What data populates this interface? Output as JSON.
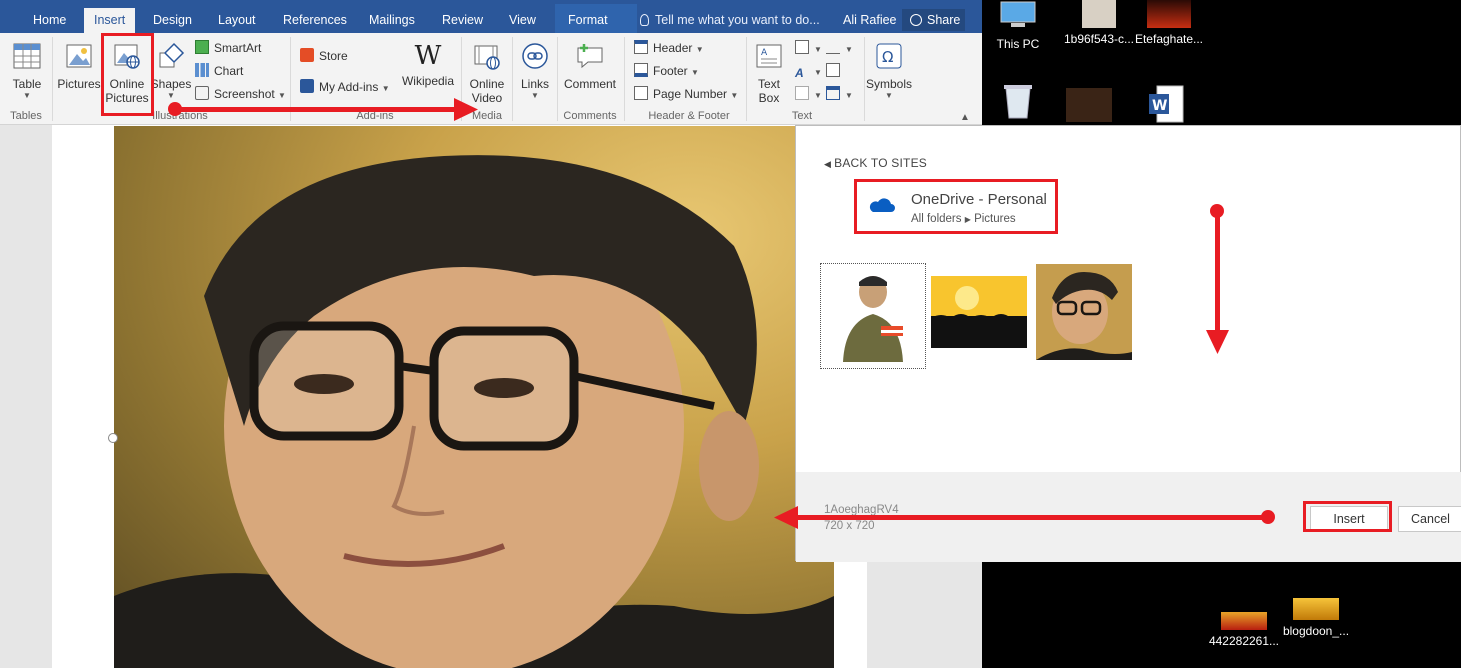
{
  "ribbon": {
    "tabs": [
      "Home",
      "Insert",
      "Design",
      "Layout",
      "References",
      "Mailings",
      "Review",
      "View",
      "Format"
    ],
    "active_tab": "Insert",
    "search_placeholder": "Tell me what you want to do...",
    "user": "Ali Rafiee",
    "share": "Share",
    "table_label": "Table",
    "pictures_label": "Pictures",
    "online_pictures_label1": "Online",
    "online_pictures_label2": "Pictures",
    "shapes_label": "Shapes",
    "smartart_label": "SmartArt",
    "chart_label": "Chart",
    "screenshot_label": "Screenshot",
    "store_label": "Store",
    "myaddins_label": "My Add-ins",
    "wikipedia_label": "Wikipedia",
    "online_video_label1": "Online",
    "online_video_label2": "Video",
    "links_label": "Links",
    "comment_label": "Comment",
    "header_label": "Header",
    "footer_label": "Footer",
    "page_number_label": "Page Number",
    "textbox_label1": "Text",
    "textbox_label2": "Box",
    "symbols_label": "Symbols",
    "groups": {
      "tables": "Tables",
      "illustrations": "Illustrations",
      "addins": "Add-ins",
      "media": "Media",
      "comments": "Comments",
      "header_footer": "Header & Footer",
      "text": "Text"
    }
  },
  "desktop": {
    "icons": [
      {
        "label": "This PC"
      },
      {
        "label": "1b96f543-c..."
      },
      {
        "label": "Etefaghate..."
      },
      {
        "label": "442282261..."
      },
      {
        "label": "blogdoon_..."
      }
    ]
  },
  "dialog": {
    "back_label": "BACK TO SITES",
    "source_title": "OneDrive - Personal",
    "path_root": "All folders",
    "path_current": "Pictures",
    "selected_name": "1AoeghagRV4",
    "selected_size": "720 x 720",
    "insert_label": "Insert",
    "cancel_label": "Cancel"
  },
  "colors": {
    "word_blue": "#2b579a",
    "highlight_red": "#e81c23"
  }
}
